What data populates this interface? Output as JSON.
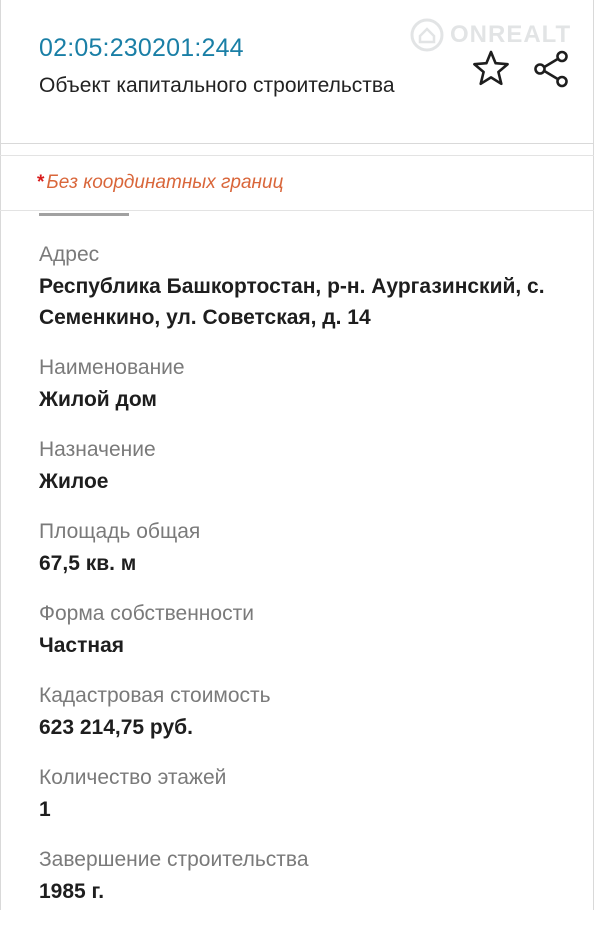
{
  "header": {
    "cadastral_number": "02:05:230201:244",
    "object_type": "Объект капитального строительства",
    "watermark": "ONREALT"
  },
  "notice": {
    "marker": "*",
    "text": "Без координатных границ"
  },
  "fields": [
    {
      "label": "Адрес",
      "value": "Республика Башкортостан, р-н. Аургазинский, с. Семенкино, ул. Советская, д. 14"
    },
    {
      "label": "Наименование",
      "value": "Жилой дом"
    },
    {
      "label": "Назначение",
      "value": "Жилое"
    },
    {
      "label": "Площадь общая",
      "value": "67,5 кв. м"
    },
    {
      "label": "Форма собственности",
      "value": "Частная"
    },
    {
      "label": "Кадастровая стоимость",
      "value": "623 214,75 руб."
    },
    {
      "label": "Количество этажей",
      "value": "1"
    },
    {
      "label": "Завершение строительства",
      "value": "1985 г."
    }
  ],
  "icons": {
    "favorite": "star-outline-icon",
    "share": "share-icon",
    "watermark_logo": "house-logo-icon"
  },
  "colors": {
    "link": "#1a7fa6",
    "notice": "#d9663a",
    "required_marker": "#d91c1c"
  }
}
